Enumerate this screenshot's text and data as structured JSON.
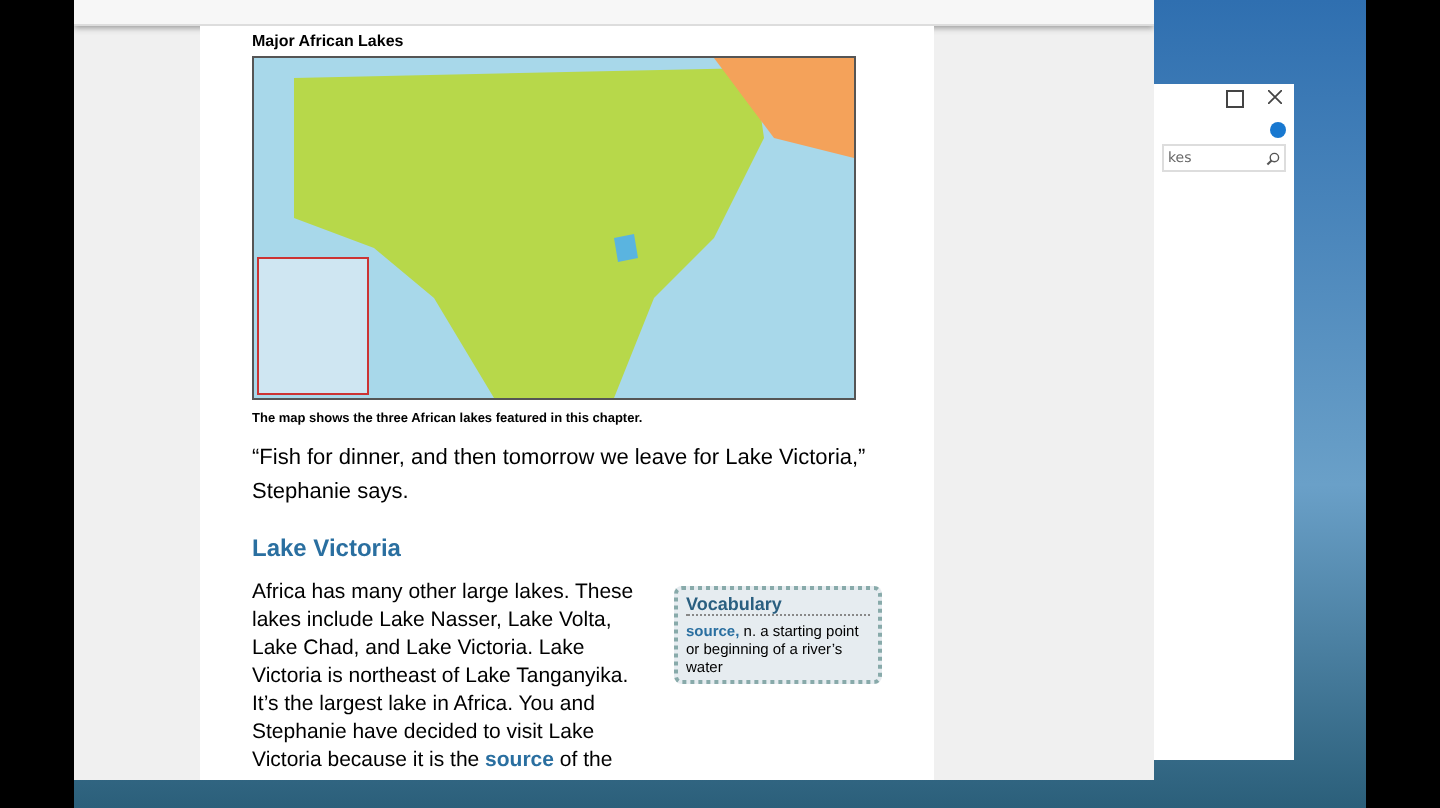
{
  "document": {
    "figure_title": "Major African Lakes",
    "caption": "The map shows the three African lakes featured in this chapter.",
    "quote": "“Fish for dinner, and then tomorrow we leave for Lake Victoria,” Stephanie says.",
    "heading": "Lake Victoria",
    "paragraph": "Africa has many other large lakes. These lakes include Lake Nasser, Lake Volta, Lake Chad, and Lake Victoria. Lake Victoria is northeast of Lake Tanganyika. It’s the largest lake in Africa. You and Stephanie have decided to visit Lake Victoria because it is the **source** of the",
    "vocabulary": {
      "title": "Vocabulary",
      "term": "source,",
      "definition": "n. a starting point or beginning of a river’s water"
    }
  },
  "explorer": {
    "search": {
      "value": "kes"
    }
  }
}
